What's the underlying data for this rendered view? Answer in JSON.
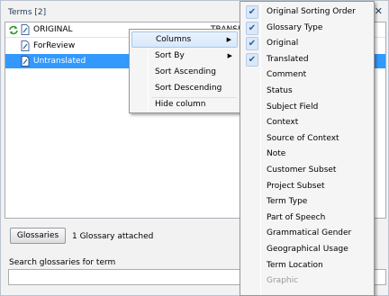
{
  "panel": {
    "title": "Terms [2]",
    "close_glyph": "✕"
  },
  "list": {
    "columns": [
      "ORIGINAL",
      "TRANSL"
    ],
    "rows": [
      {
        "label": "ForReview",
        "selected": false,
        "icon": "document-icon"
      },
      {
        "label": "Untranslated",
        "selected": true,
        "icon": "document-icon"
      }
    ]
  },
  "glossary_bar": {
    "button_label": "Glossaries",
    "attached_text": "1 Glossary attached"
  },
  "search": {
    "label": "Search glossaries for term",
    "value": "",
    "placeholder": ""
  },
  "context_menu": {
    "items": [
      {
        "label": "Columns",
        "submenu": true,
        "hover": true
      },
      {
        "label": "Sort By",
        "submenu": true,
        "hover": false
      },
      {
        "label": "Sort Ascending",
        "submenu": false,
        "hover": false
      },
      {
        "label": "Sort Descending",
        "submenu": false,
        "hover": false
      },
      {
        "label": "Hide column",
        "submenu": false,
        "hover": false
      }
    ],
    "submenu_arrow": "▶"
  },
  "columns_menu": {
    "check_glyph": "✔",
    "items": [
      {
        "label": "Original Sorting Order",
        "checked": true,
        "enabled": true
      },
      {
        "label": "Glossary Type",
        "checked": true,
        "enabled": true
      },
      {
        "label": "Original",
        "checked": true,
        "enabled": true
      },
      {
        "label": "Translated",
        "checked": true,
        "enabled": true
      },
      {
        "label": "Comment",
        "checked": false,
        "enabled": true
      },
      {
        "label": "Status",
        "checked": false,
        "enabled": true
      },
      {
        "label": "Subject Field",
        "checked": false,
        "enabled": true
      },
      {
        "label": "Context",
        "checked": false,
        "enabled": true
      },
      {
        "label": "Source of Context",
        "checked": false,
        "enabled": true
      },
      {
        "label": "Note",
        "checked": false,
        "enabled": true
      },
      {
        "label": "Customer Subset",
        "checked": false,
        "enabled": true
      },
      {
        "label": "Project Subset",
        "checked": false,
        "enabled": true
      },
      {
        "label": "Term Type",
        "checked": false,
        "enabled": true
      },
      {
        "label": "Part of Speech",
        "checked": false,
        "enabled": true
      },
      {
        "label": "Grammatical Gender",
        "checked": false,
        "enabled": true
      },
      {
        "label": "Geographical Usage",
        "checked": false,
        "enabled": true
      },
      {
        "label": "Term Location",
        "checked": false,
        "enabled": true
      },
      {
        "label": "Graphic",
        "checked": false,
        "enabled": false
      }
    ]
  },
  "colors": {
    "selection": "#3399ff",
    "menu_bg": "#f5f5f5",
    "check": "#2c5f9e"
  }
}
